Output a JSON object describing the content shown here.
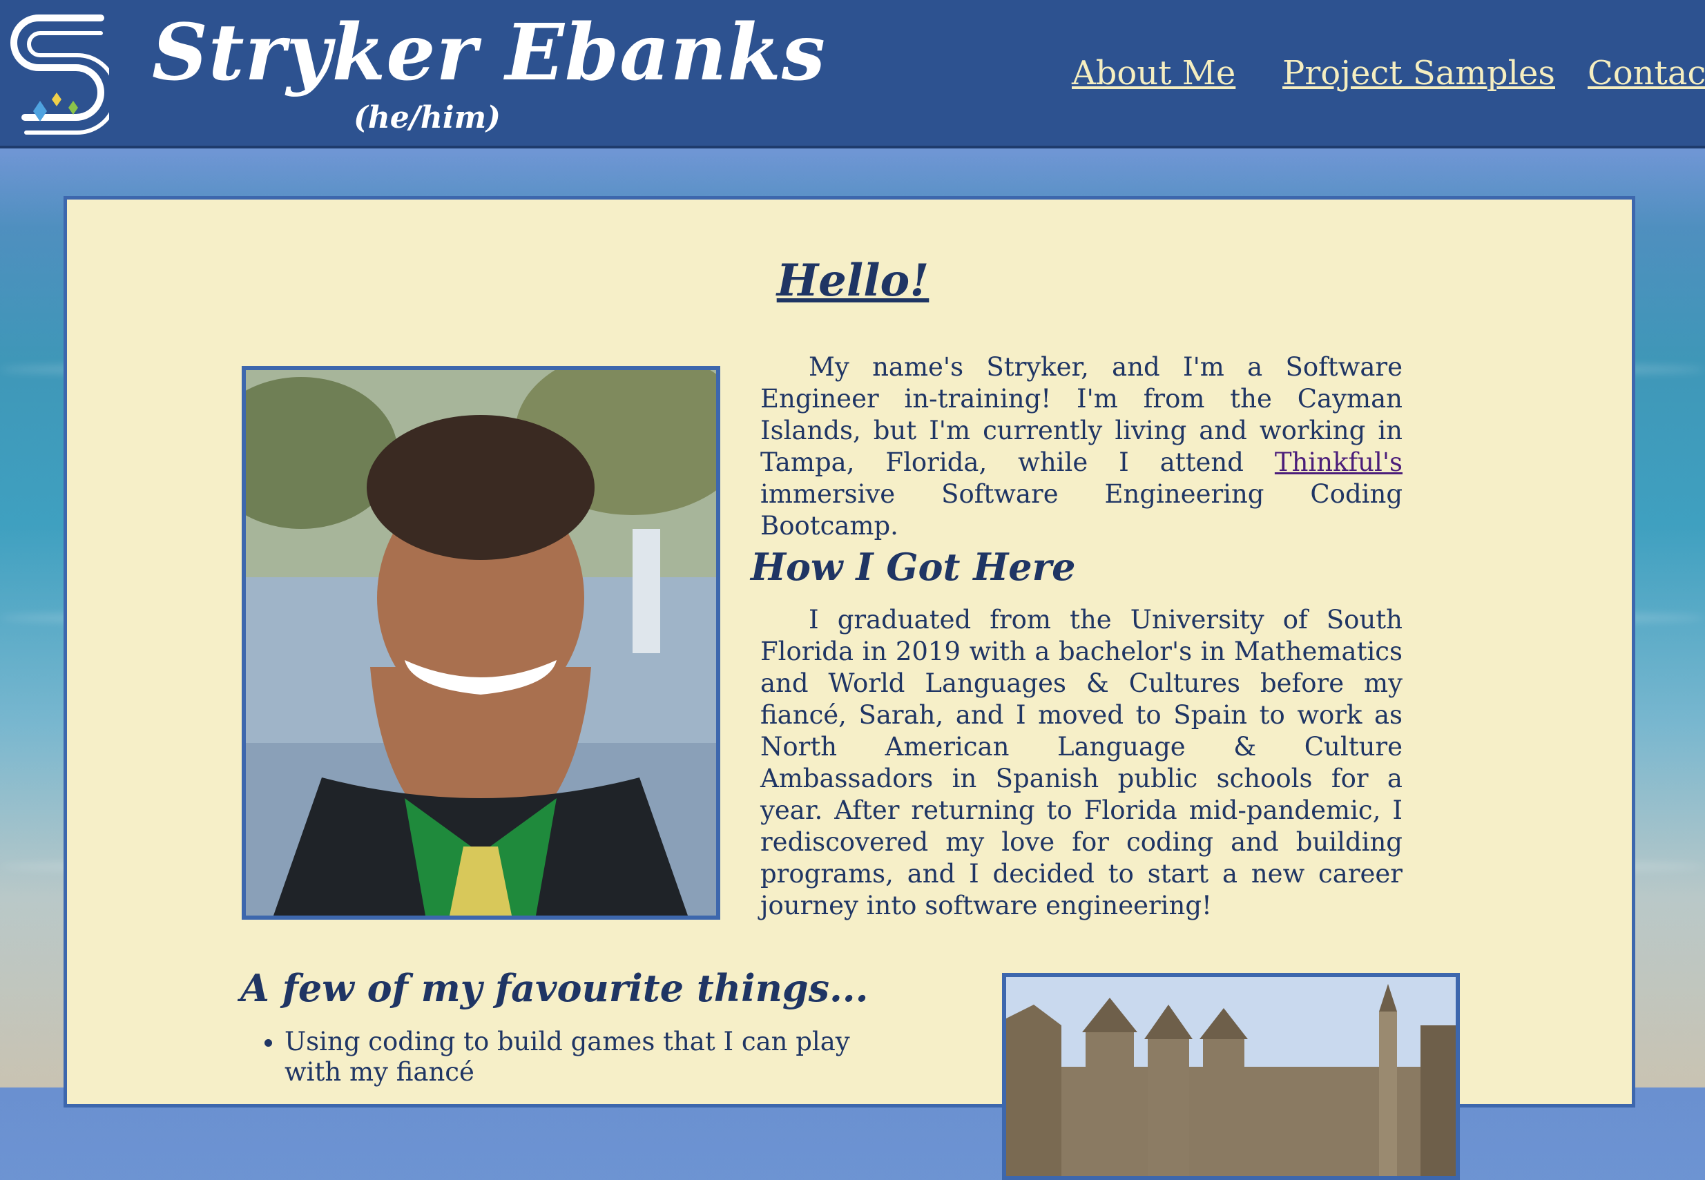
{
  "header": {
    "name": "Stryker Ebanks",
    "pronouns": "(he/him)",
    "nav": [
      {
        "label": "About Me"
      },
      {
        "label": "Project Samples"
      },
      {
        "label": "Contact"
      }
    ]
  },
  "main": {
    "hello": "Hello!",
    "intro": {
      "before_link": "My name's Stryker, and I'm a Software Engineer in-training! I'm from the Cayman Islands, but I'm currently living and working in Tampa, Florida, while I attend ",
      "link": "Thinkful's",
      "after_link": " immersive Software Engineering Coding Bootcamp."
    },
    "how_heading": "How I Got Here",
    "how_text": "I graduated from the University of South Florida in 2019 with a bachelor's in Mathematics and World Languages & Cultures before my fiancé, Sarah, and I moved to Spain to work as North American Language & Culture Ambassadors in Spanish public schools for a year. After returning to Florida mid-pandemic, I rediscovered my love for coding and building programs, and I decided to start a new career journey into software engineering!",
    "favs_heading": "A few of my favourite things...",
    "favs": [
      "Using coding to build games that I can play with my fiancé"
    ]
  },
  "colors": {
    "header_bg": "#2d5290",
    "nav_link": "#f5eec0",
    "card_bg": "#f6efc8",
    "text": "#1f3564",
    "frame": "#3d67ad"
  }
}
